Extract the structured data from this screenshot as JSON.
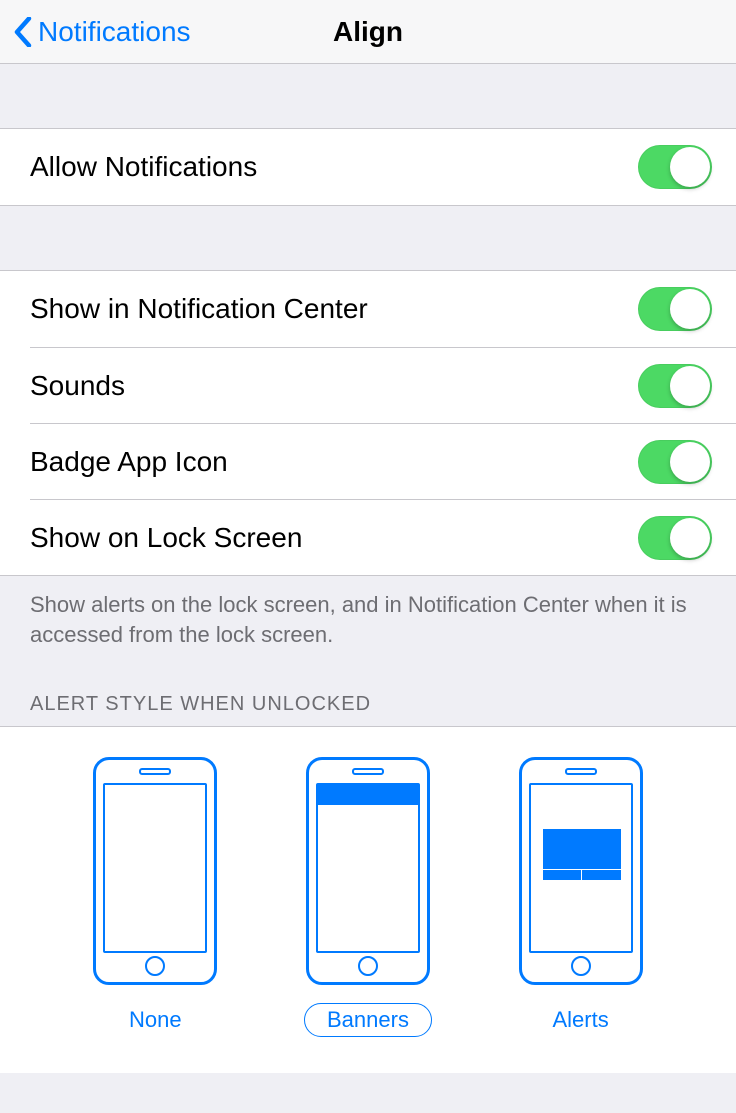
{
  "header": {
    "back_label": "Notifications",
    "title": "Align"
  },
  "toggles": {
    "allow": {
      "label": "Allow Notifications",
      "on": true
    },
    "nc": {
      "label": "Show in Notification Center",
      "on": true
    },
    "sounds": {
      "label": "Sounds",
      "on": true
    },
    "badge": {
      "label": "Badge App Icon",
      "on": true
    },
    "lock": {
      "label": "Show on Lock Screen",
      "on": true
    }
  },
  "lock_footer": "Show alerts on the lock screen, and in Notification Center when it is accessed from the lock screen.",
  "alert_style_header": "ALERT STYLE WHEN UNLOCKED",
  "styles": {
    "none": {
      "label": "None",
      "selected": false
    },
    "banners": {
      "label": "Banners",
      "selected": true
    },
    "alerts": {
      "label": "Alerts",
      "selected": false
    }
  }
}
